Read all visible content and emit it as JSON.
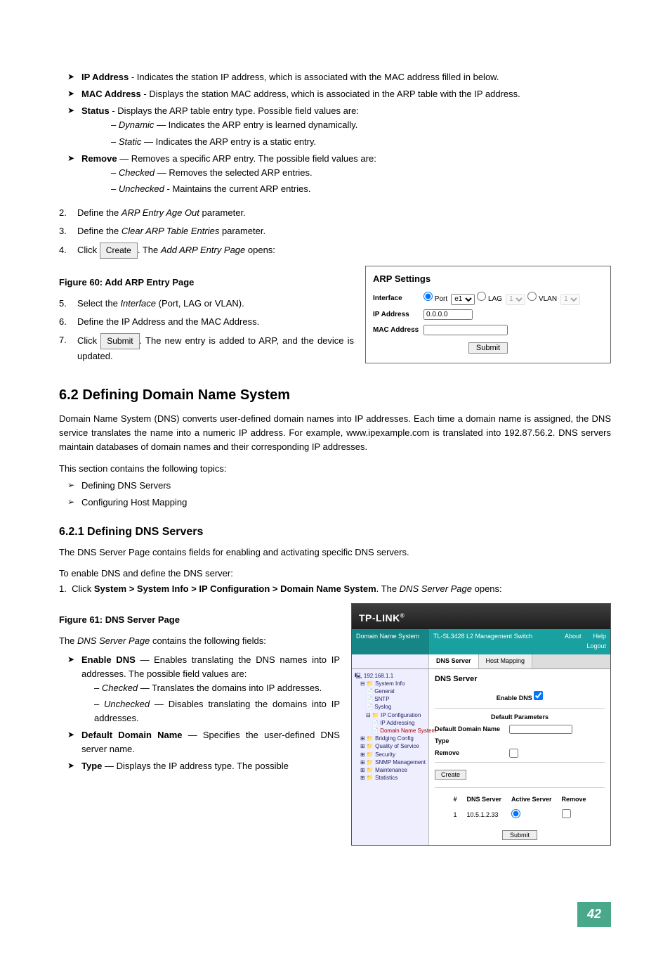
{
  "top_bullets": [
    {
      "term": "IP Address",
      "desc": " - Indicates the station IP address, which is associated with the MAC address filled in below."
    },
    {
      "term": "MAC Address",
      "desc": " - Displays the station MAC address, which is associated in the ARP table with the IP address."
    },
    {
      "term": "Status",
      "desc": " - Displays the ARP table entry type. Possible field values are:"
    }
  ],
  "status_sub": [
    {
      "em": "Dynamic",
      "desc": " — Indicates the ARP entry is learned dynamically."
    },
    {
      "em": "Static",
      "desc": " — Indicates the ARP entry is a static entry."
    }
  ],
  "remove_bullet": {
    "term": "Remove",
    "desc": " — Removes a specific ARP entry. The possible field values are:"
  },
  "remove_sub": [
    {
      "em": "Checked",
      "desc": " — Removes the selected ARP entries."
    },
    {
      "em": "Unchecked",
      "desc": " - Maintains the current ARP entries."
    }
  ],
  "steps234": {
    "s2": {
      "n": "2.",
      "pre": "Define the ",
      "em": "ARP Entry Age Out",
      "post": " parameter."
    },
    "s3": {
      "n": "3.",
      "pre": "Define the ",
      "em": "Clear ARP Table Entries",
      "post": " parameter."
    },
    "s4": {
      "n": "4.",
      "pre": "Click ",
      "btn": "Create",
      "mid": ". The ",
      "em": "Add ARP Entry Page",
      "post": " opens:"
    }
  },
  "fig60": "Figure 60: Add ARP Entry Page",
  "steps567": {
    "s5": {
      "n": "5.",
      "pre": "Select the ",
      "em": "Interface",
      "post": " (Port, LAG or VLAN)."
    },
    "s6": {
      "n": "6.",
      "txt": "Define the IP Address and the MAC Address."
    },
    "s7": {
      "n": "7.",
      "pre": "Click ",
      "btn": "Submit",
      "post": ". The new entry is added to ARP, and the device is updated."
    }
  },
  "arp_panel": {
    "title": "ARP Settings",
    "interface": "Interface",
    "port_lbl": "Port",
    "port_val": "e1",
    "lag_lbl": "LAG",
    "lag_val": "1",
    "vlan_lbl": "VLAN",
    "vlan_val": "1",
    "ip_lbl": "IP Address",
    "ip_val": "0.0.0.0",
    "mac_lbl": "MAC Address",
    "submit": "Submit"
  },
  "sec62": {
    "heading": "6.2  Defining Domain Name System",
    "p1": "Domain Name System (DNS) converts user-defined domain names into IP addresses. Each time a domain name is assigned, the DNS service translates the name into a numeric IP address. For example, www.ipexample.com is translated into 192.87.56.2. DNS servers maintain databases of domain names and their corresponding IP addresses.",
    "p2": "This section contains the following topics:",
    "topics": [
      "Defining DNS Servers",
      "Configuring Host Mapping"
    ]
  },
  "sec621": {
    "heading": "6.2.1  Defining DNS Servers",
    "p1": "The DNS Server Page contains fields for enabling and activating specific DNS servers.",
    "p2": "To enable DNS and define the DNS server:",
    "step1_pre": "Click ",
    "step1_bold": "System > System Info > IP Configuration > Domain Name System",
    "step1_mid": ". The ",
    "step1_em": "DNS Server Page",
    "step1_post": " opens:",
    "fig61": "Figure 61: DNS Server Page",
    "intro": {
      "pre": "The ",
      "em": "DNS Server Page",
      "post": " contains the following fields:"
    },
    "fields": {
      "enable": {
        "term": "Enable DNS",
        "desc": " — Enables translating the DNS names into IP addresses. The possible field values are:"
      },
      "enable_sub": [
        {
          "em": "Checked",
          "desc": " — Translates the domains into IP addresses."
        },
        {
          "em": "Unchecked",
          "desc": " — Disables translating the domains into IP addresses."
        }
      ],
      "ddn": {
        "term": "Default Domain Name",
        "desc": " — Specifies the user-defined DNS server name."
      },
      "type": {
        "term": "Type",
        "desc": " — Displays the IP address type. The possible"
      }
    }
  },
  "dns_shot": {
    "brand": "TP-LINK",
    "left_title": "Domain Name System",
    "mid_title": "TL-SL3428 L2 Management Switch",
    "about": "About",
    "help": "Help",
    "logout": "Logout",
    "tab1": "DNS Server",
    "tab2": "Host Mapping",
    "tree": {
      "root": "192.168.1.1",
      "sys": "System Info",
      "gen": "General",
      "sntp": "SNTP",
      "syslog": "Syslog",
      "ipconf": "IP Configuration",
      "ipaddr": "IP Addressing",
      "dns": "Domain Name System",
      "bridge": "Bridging Config",
      "qos": "Quality of Service",
      "sec": "Security",
      "snmp": "SNMP Management",
      "maint": "Maintenance",
      "stats": "Statistics"
    },
    "main": {
      "h": "DNS Server",
      "enable": "Enable DNS",
      "def_params": "Default Parameters",
      "ddn": "Default Domain Name",
      "type": "Type",
      "remove": "Remove",
      "create": "Create",
      "th1": "#",
      "th2": "DNS Server",
      "th3": "Active Server",
      "th4": "Remove",
      "r1n": "1",
      "r1ip": "10.5.1.2.33",
      "submit": "Submit"
    }
  },
  "pagenum": "42"
}
